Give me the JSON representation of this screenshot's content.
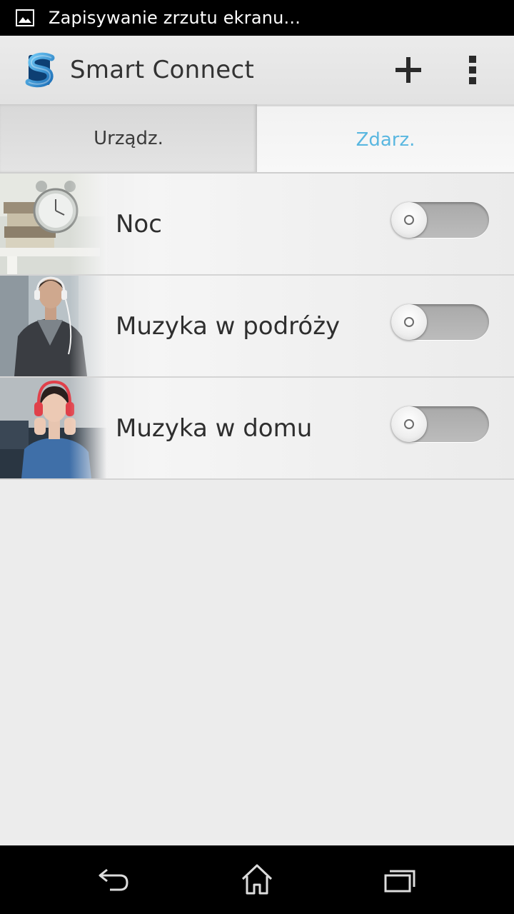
{
  "status_bar": {
    "notification_icon": "image-icon",
    "text": "Zapisywanie zrzutu ekranu..."
  },
  "action_bar": {
    "app_icon": "smart-connect-logo",
    "title": "Smart Connect",
    "add_icon": "plus-icon",
    "menu_icon": "overflow-menu-icon"
  },
  "tabs": [
    {
      "label": "Urządz.",
      "selected": false
    },
    {
      "label": "Zdarz.",
      "selected": true
    }
  ],
  "events": [
    {
      "label": "Noc",
      "thumbnail": "alarm-clock-books-photo",
      "enabled": false
    },
    {
      "label": "Muzyka w podróży",
      "thumbnail": "man-with-headphones-photo",
      "enabled": false
    },
    {
      "label": "Muzyka w domu",
      "thumbnail": "woman-with-headphones-photo",
      "enabled": false
    }
  ],
  "nav_bar": {
    "back_icon": "back-icon",
    "home_icon": "home-icon",
    "recents_icon": "recent-apps-icon"
  },
  "colors": {
    "accent_tab": "#5ab7e0",
    "status_bar": "#000000",
    "nav_bar": "#000000"
  }
}
